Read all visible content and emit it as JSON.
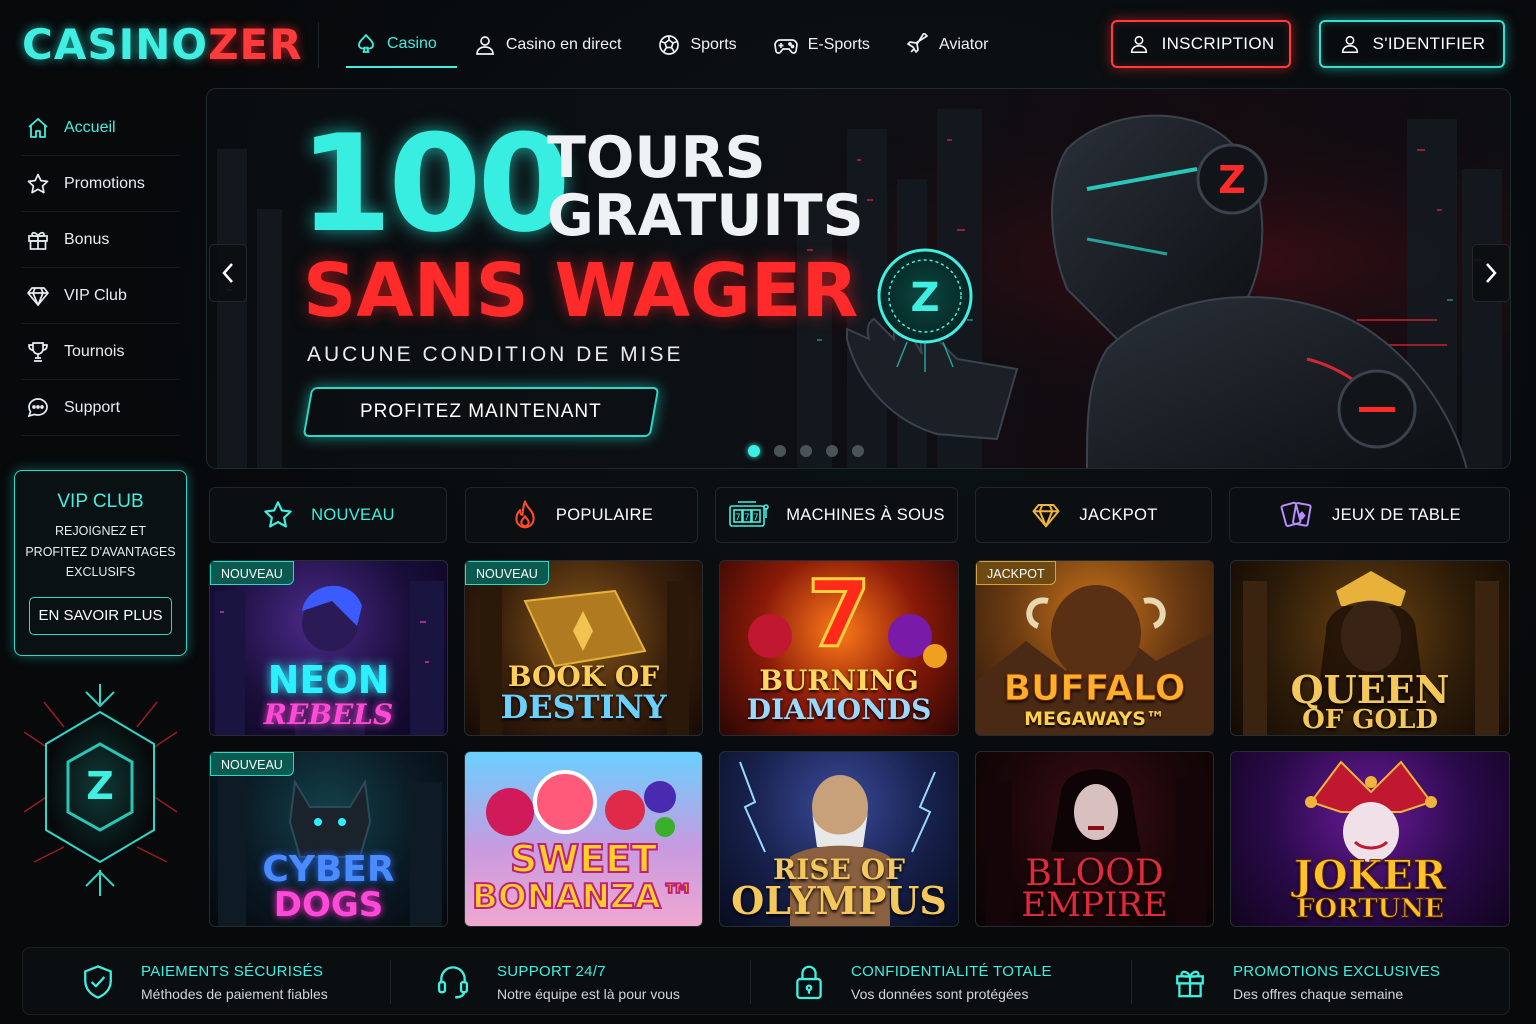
{
  "brand": {
    "logo_part1": "CASINO",
    "logo_part2": "ZER"
  },
  "nav": {
    "items": [
      {
        "label": "Casino",
        "icon": "spade-icon",
        "active": true
      },
      {
        "label": "Casino en direct",
        "icon": "user-icon"
      },
      {
        "label": "Sports",
        "icon": "soccer-ball-icon"
      },
      {
        "label": "E-Sports",
        "icon": "gamepad-icon"
      },
      {
        "label": "Aviator",
        "icon": "plane-icon"
      }
    ],
    "register_label": "INSCRIPTION",
    "login_label": "S'IDENTIFIER"
  },
  "sidebar": {
    "items": [
      {
        "label": "Accueil",
        "icon": "home-icon",
        "active": true
      },
      {
        "label": "Promotions",
        "icon": "star-icon"
      },
      {
        "label": "Bonus",
        "icon": "gift-icon"
      },
      {
        "label": "VIP Club",
        "icon": "diamond-icon"
      },
      {
        "label": "Tournois",
        "icon": "trophy-icon"
      },
      {
        "label": "Support",
        "icon": "chat-icon"
      }
    ],
    "vip_box": {
      "title": "VIP CLUB",
      "line1": "REJOIGNEZ ET",
      "line2": "PROFITEZ D'AVANTAGES",
      "line3": "EXCLUSIFS",
      "button": "EN SAVOIR PLUS"
    }
  },
  "hero": {
    "number": "100",
    "line1": "TOURS",
    "line2": "GRATUITS",
    "headline": "SANS WAGER",
    "subtitle": "AUCUNE CONDITION DE MISE",
    "cta": "PROFITEZ MAINTENANT",
    "slide_count": 5,
    "active_slide": 1,
    "coin_letter": "Z"
  },
  "categories": [
    {
      "label": "NOUVEAU",
      "icon": "star-icon"
    },
    {
      "label": "POPULAIRE",
      "icon": "flame-icon"
    },
    {
      "label": "MACHINES À SOUS",
      "icon": "slot-machine-icon"
    },
    {
      "label": "JACKPOT",
      "icon": "diamond-icon"
    },
    {
      "label": "JEUX DE TABLE",
      "icon": "cards-icon"
    }
  ],
  "games": [
    {
      "line1": "NEON",
      "line2": "REBELS",
      "tag": "NOUVEAU"
    },
    {
      "line1": "BOOK OF",
      "line2": "DESTINY",
      "tag": "NOUVEAU"
    },
    {
      "line1": "BURNING",
      "line2": "DIAMONDS",
      "badge": "7"
    },
    {
      "line1": "BUFFALO",
      "line2": "MEGAWAYS™",
      "tag": "JACKPOT"
    },
    {
      "line1": "QUEEN",
      "line2": "OF GOLD"
    },
    {
      "line1": "CYBER",
      "line2": "DOGS",
      "tag": "NOUVEAU"
    },
    {
      "line1": "SWEET",
      "line2": "BONANZA™"
    },
    {
      "line1": "RISE OF",
      "line2": "OLYMPUS"
    },
    {
      "line1": "BLOOD",
      "line2": "EMPIRE"
    },
    {
      "line1": "JOKER",
      "line2": "FORTUNE"
    }
  ],
  "footer": [
    {
      "title": "PAIEMENTS SÉCURISÉS",
      "text": "Méthodes de paiement fiables",
      "icon": "shield-check-icon"
    },
    {
      "title": "SUPPORT 24/7",
      "text": "Notre équipe est là pour vous",
      "icon": "headset-icon"
    },
    {
      "title": "CONFIDENTIALITÉ TOTALE",
      "text": "Vos données sont protégées",
      "icon": "lock-icon"
    },
    {
      "title": "PROMOTIONS EXCLUSIVES",
      "text": "Des offres chaque semaine",
      "icon": "gift-icon"
    }
  ],
  "colors": {
    "accent": "#3ff0e2",
    "danger": "#ff3b3b",
    "background": "#07090b"
  }
}
